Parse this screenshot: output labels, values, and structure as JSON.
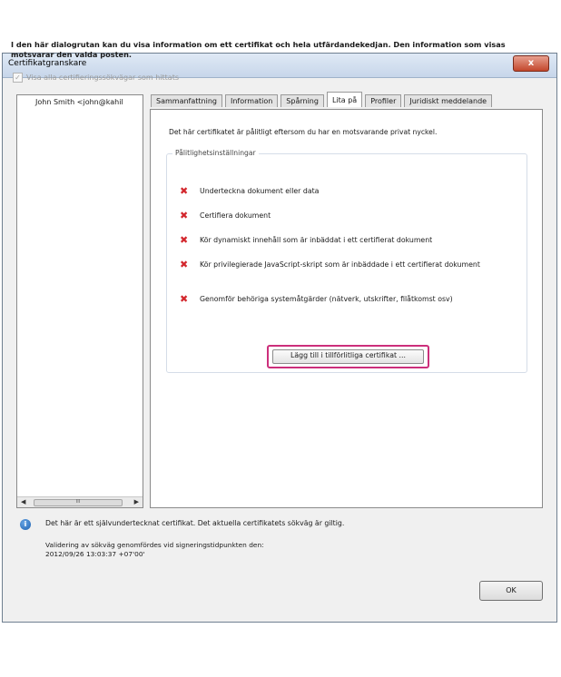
{
  "window": {
    "title": "Certifikatgranskare",
    "close_label": "x"
  },
  "intro_text": "I den här dialogrutan kan du visa information om ett certifikat och hela utfärdandekedjan. Den information som visas motsvarar den valda posten.",
  "show_all_paths": {
    "label": "Visa alla certifieringssökvägar som hittats",
    "checked": true
  },
  "certificate_list": [
    "John Smith <john@kahil"
  ],
  "scrollbar_thumb": "III",
  "tabs": [
    "Sammanfattning",
    "Information",
    "Spårning",
    "Lita på",
    "Profiler",
    "Juridiskt meddelande"
  ],
  "active_tab": "Lita på",
  "trust": {
    "description": "Det här certifikatet är pålitligt eftersom du har en motsvarande privat nyckel.",
    "group_label": "Pålitlighetsinställningar",
    "items": [
      "Underteckna dokument eller data",
      "Certifiera dokument",
      "Kör dynamiskt innehåll som är inbäddat i ett certifierat dokument",
      "Kör privilegierade JavaScript-skript som är inbäddade i ett certifierat dokument",
      "Genomför behöriga systemåtgärder (nätverk, utskrifter, filåtkomst osv)"
    ],
    "add_button": "Lägg till i tillförlitliga certifikat ..."
  },
  "status": "Det här är ett självundertecknat certifikat. Det aktuella certifikatets sökväg är giltig.",
  "validation_line1": "Validering av sökväg genomfördes vid signeringstidpunkten den:",
  "validation_line2": "2012/09/26 13:03:37 +07'00'",
  "ok_label": "OK",
  "colors": {
    "highlight": "#cc2f7b",
    "deny_icon": "#d3272d"
  }
}
